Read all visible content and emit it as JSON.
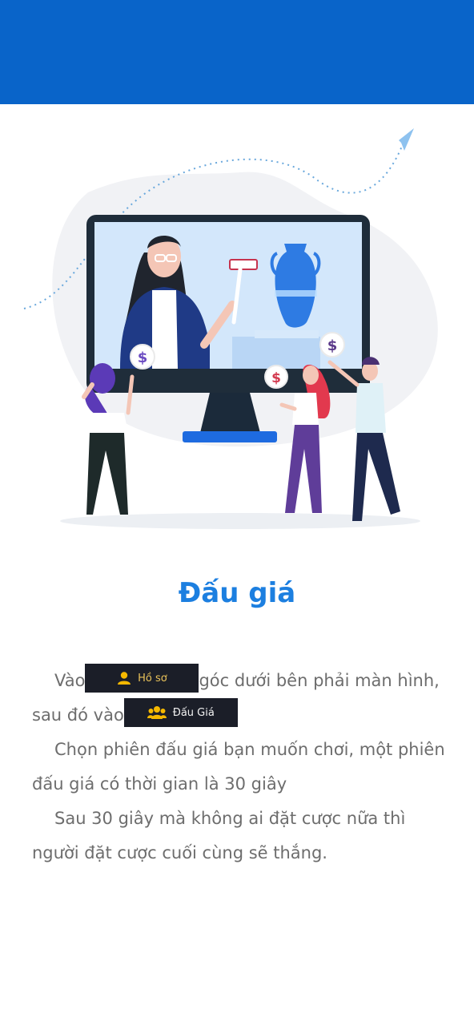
{
  "header": {
    "color": "#0964c9"
  },
  "illustration": {
    "name": "auction-illustration",
    "bid_sign_symbol": "$"
  },
  "page": {
    "title": "Đấu giá"
  },
  "instructions": {
    "p1_prefix": "Vào",
    "profile_chip": {
      "label": "Hồ sơ",
      "icon": "user-icon"
    },
    "p1_mid": "góc dưới bên phải màn hình, sau đó vào",
    "auction_chip": {
      "label": "Đấu Giá",
      "icon": "users-icon"
    },
    "p2": "Chọn phiên đấu giá bạn muốn chơi, một phiên đấu giá có thời gian là 30 giây",
    "p3": "Sau 30 giây mà không ai đặt cược nữa thì người đặt cược cuối cùng sẽ thắng."
  },
  "colors": {
    "accent": "#1c7fe0",
    "text": "#6d6d6d",
    "chip_bg": "#1b1e28",
    "chip_gold": "#f5b800"
  }
}
